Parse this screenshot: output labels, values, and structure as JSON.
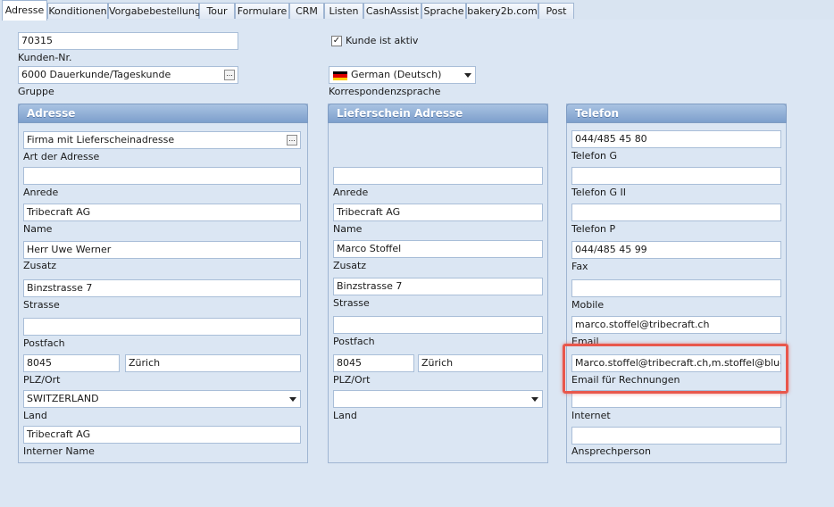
{
  "tabs": [
    "Adresse",
    "Konditionen",
    "Vorgabebestellung",
    "Tour",
    "Formulare",
    "CRM",
    "Listen",
    "CashAssist",
    "Sprache",
    "bakery2b.com",
    "Post"
  ],
  "top": {
    "customer_no": "70315",
    "customer_no_label": "Kunden-Nr.",
    "group_value": "6000 Dauerkunde/Tageskunde",
    "group_label": "Gruppe",
    "active_label": "Kunde ist aktiv",
    "language_value": "German (Deutsch)",
    "language_label": "Korrespondenzsprache"
  },
  "address": {
    "title": "Adresse",
    "type_value": "Firma mit Lieferscheinadresse",
    "type_label": "Art der Adresse",
    "anrede_value": "",
    "anrede_label": "Anrede",
    "name_value": "Tribecraft AG",
    "name_label": "Name",
    "zusatz_value": "Herr Uwe Werner",
    "zusatz_label": "Zusatz",
    "strasse_value": "Binzstrasse 7",
    "strasse_label": "Strasse",
    "postfach_value": "",
    "postfach_label": "Postfach",
    "plz_value": "8045",
    "ort_value": "Zürich",
    "plzort_label": "PLZ/Ort",
    "land_value": "SWITZERLAND",
    "land_label": "Land",
    "internal_value": "Tribecraft AG",
    "internal_label": "Interner Name"
  },
  "delivery": {
    "title": "Lieferschein Adresse",
    "anrede_value": "",
    "anrede_label": "Anrede",
    "name_value": "Tribecraft AG",
    "name_label": "Name",
    "zusatz_value": "Marco Stoffel",
    "zusatz_label": "Zusatz",
    "strasse_value": "Binzstrasse 7",
    "strasse_label": "Strasse",
    "postfach_value": "",
    "postfach_label": "Postfach",
    "plz_value": "8045",
    "ort_value": "Zürich",
    "plzort_label": "PLZ/Ort",
    "land_value": "",
    "land_label": "Land"
  },
  "phone": {
    "title": "Telefon",
    "tel_g_value": "044/485 45 80",
    "tel_g_label": "Telefon G",
    "tel_g2_value": "",
    "tel_g2_label": "Telefon G II",
    "tel_p_value": "",
    "tel_p_label": "Telefon P",
    "fax_value": "044/485 45 99",
    "fax_label": "Fax",
    "mobile_value": "",
    "mobile_label": "Mobile",
    "email_value": "marco.stoffel@tribecraft.ch",
    "email_label": "Email",
    "email_invoice_value": "Marco.stoffel@tribecraft.ch,m.stoffel@bluewi",
    "email_invoice_label": "Email für Rechnungen",
    "internet_value": "",
    "internet_label": "Internet",
    "contact_value": "",
    "contact_label": "Ansprechperson"
  },
  "colors": {
    "highlight": "#e8574c",
    "panel_header": "#8aa9d3"
  }
}
